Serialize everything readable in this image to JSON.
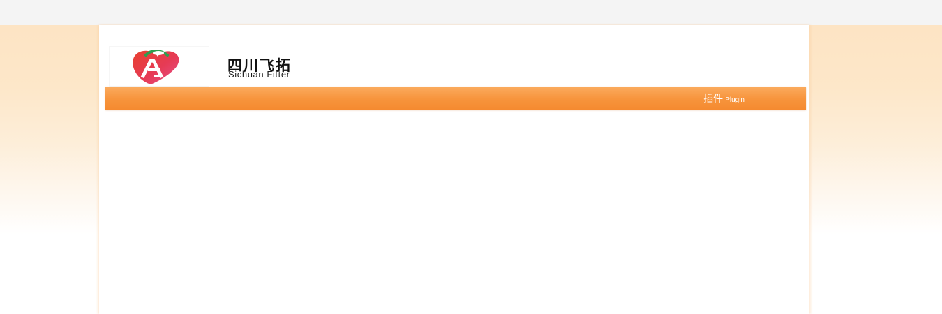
{
  "brand": {
    "name_cn": "四川飞拓",
    "name_en": "Sichuan Fitter",
    "logo_icon": "fitter-logo-icon"
  },
  "nav": {
    "items": [
      {
        "label_cn": "插件",
        "label_en": "Plugin"
      }
    ]
  },
  "colors": {
    "nav_orange": "#f7943c",
    "page_peach": "#fde4c4",
    "logo_red": "#e63a3a",
    "logo_pink": "#e8508c",
    "logo_green": "#2e9e4f"
  }
}
